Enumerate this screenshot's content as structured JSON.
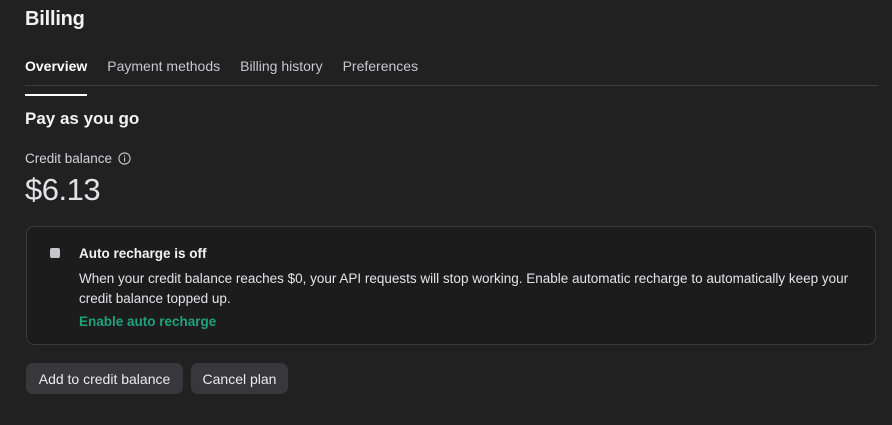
{
  "header": {
    "title": "Billing"
  },
  "tabs": [
    {
      "label": "Overview",
      "active": true
    },
    {
      "label": "Payment methods",
      "active": false
    },
    {
      "label": "Billing history",
      "active": false
    },
    {
      "label": "Preferences",
      "active": false
    }
  ],
  "plan": {
    "title": "Pay as you go",
    "balance_label": "Credit balance",
    "balance_icon": "info-icon",
    "balance_amount": "$6.13"
  },
  "auto_recharge": {
    "enabled": false,
    "title": "Auto recharge is off",
    "description": "When your credit balance reaches $0, your API requests will stop working. Enable automatic recharge to automatically keep your credit balance topped up.",
    "link_label": "Enable auto recharge",
    "link_color": "#1fa27a"
  },
  "actions": {
    "add_label": "Add to credit balance",
    "cancel_label": "Cancel plan"
  },
  "colors": {
    "background": "#212122",
    "button_bg": "#37373c",
    "accent": "#1fa27a"
  }
}
